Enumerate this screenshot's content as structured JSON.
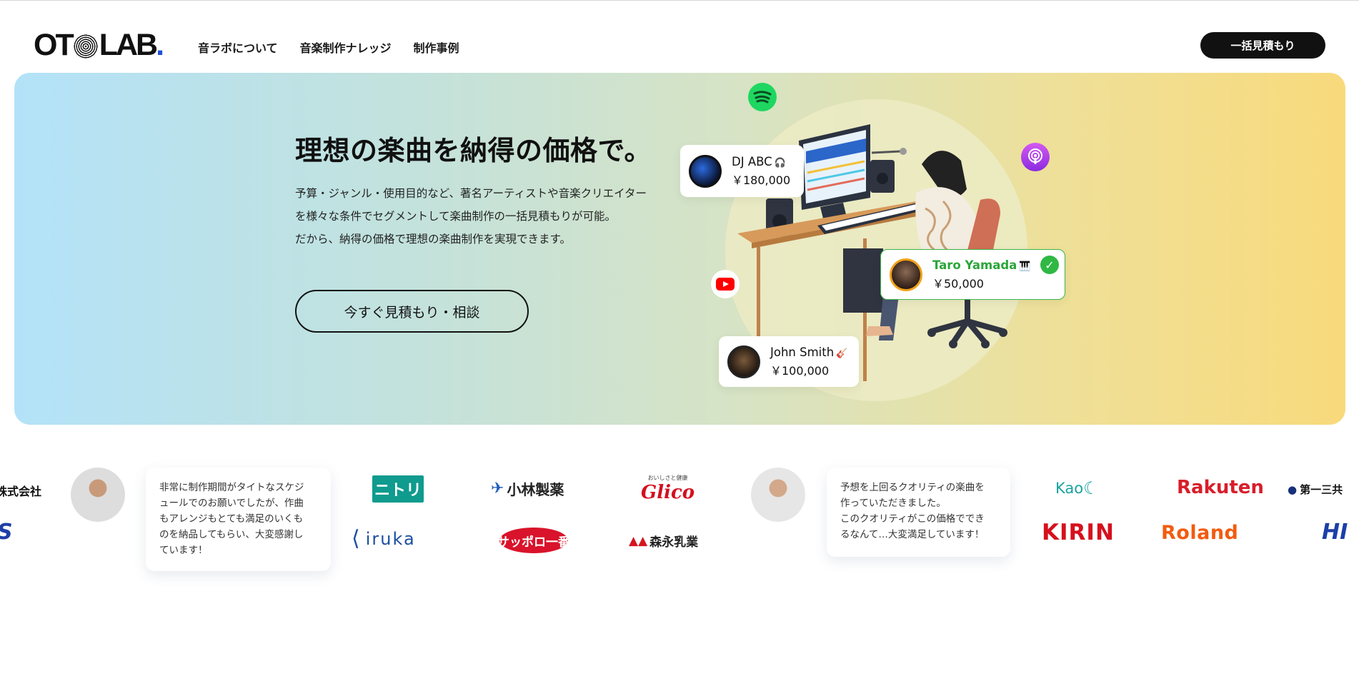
{
  "header": {
    "logo": {
      "text_left": "OT",
      "text_right": "LAB",
      "dot": "."
    },
    "nav": [
      "音ラボについて",
      "音楽制作ナレッジ",
      "制作事例"
    ],
    "cta_label": "一括見積もり"
  },
  "hero": {
    "title": "理想の楽曲を納得の価格で。",
    "description": [
      "予算・ジャンル・使用目的など、著名アーティストや音楽クリエイター",
      "を様々な条件でセグメントして楽曲制作の一括見積もりが可能。",
      "だから、納得の価格で理想の楽曲制作を実現できます。"
    ],
    "button_label": "今すぐ見積もり・相談",
    "cards": [
      {
        "name": "DJ ABC",
        "icon": "🎧",
        "price": "￥180,000"
      },
      {
        "name": "Taro Yamada",
        "icon": "🎹",
        "price": "￥50,000",
        "check": "✓"
      },
      {
        "name": "John Smith",
        "icon": "🎸",
        "price": "￥100,000"
      }
    ],
    "services": [
      "spotify-icon",
      "podcast-icon",
      "youtube-icon"
    ]
  },
  "testimonials": [
    {
      "lines": [
        "非常に制作期間がタイトなスケジ",
        "ュールでのお願いでしたが、作曲",
        "もアレンジもとても満足のいくも",
        "のを納品してもらい、大変感謝し",
        "ています！"
      ]
    },
    {
      "lines": [
        "予想を上回るクオリティの楽曲を",
        "作っていただきました。",
        "このクオリティがこの価格ででき",
        "るなんて…大変満足しています！"
      ]
    }
  ],
  "logos": {
    "kabushiki": "株式会社",
    "s_partial": "S",
    "nitori": "ニトリ",
    "iruka": "iruka",
    "kobayashi": "小林製薬",
    "sapporo": "サッポロ一番",
    "glico_sub": "おいしさと健康",
    "glico": "Glico",
    "morinaga": "森永乳業",
    "kao": "Kao",
    "kirin": "KIRIN",
    "rakuten": "Rakuten",
    "roland": "Roland",
    "daiichi": "第一三共",
    "hi_partial": "HI"
  },
  "colors": {
    "accent_dark": "#111111",
    "taro_green": "#2ba63a",
    "spotify": "#1ed760",
    "youtube": "#ff0000"
  }
}
